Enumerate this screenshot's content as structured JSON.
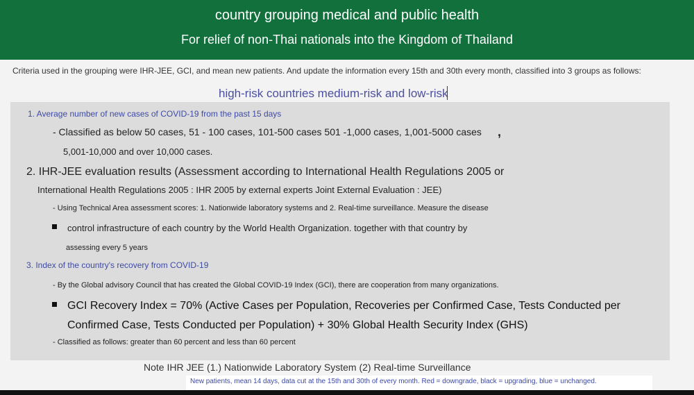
{
  "header": {
    "title": "country grouping medical and public health",
    "subtitle": "For relief of non-Thai nationals into the Kingdom of Thailand"
  },
  "criteria": "Criteria used in the grouping were IHR-JEE, GCI, and mean new patients. And update the information every 15th and 30th every month, classified into 3 groups as follows:",
  "risk_groups": "high-risk countries medium-risk and low-risk",
  "sections": {
    "s1_title": "1. Average number of new cases of COVID-19 from the past 15 days",
    "s1_line1": "- Classified as below 50 cases, 51 - 100 cases, 101-500 cases 501 -1,000 cases, 1,001-5000 cases",
    "s1_comma": ",",
    "s1_line2": "5,001-10,000 and over 10,000 cases.",
    "s2_title_line1": "2. IHR-JEE evaluation results (Assessment according to International Health Regulations 2005 or",
    "s2_title_line2": "International Health Regulations 2005 : IHR 2005 by external experts Joint External Evaluation : JEE)",
    "s2_line1": "- Using Technical Area assessment scores: 1. Nationwide laboratory systems and 2. Real-time surveillance. Measure the disease",
    "s2_bullet": "control infrastructure of each country by the World Health Organization. together with that country by",
    "s2_line3": "assessing every 5 years",
    "s3_title": "3. Index of the country's recovery from COVID-19",
    "s3_line1": "- By the Global advisory Council that has created the Global COVID-19 Index (GCI), there are cooperation from many organizations.",
    "s3_bullet_line1": "GCI Recovery Index  = 70% (Active Cases per Population, Recoveries per Confirmed Case, Tests Conducted per",
    "s3_bullet_line2": "Confirmed Case, Tests Conducted per Population) + 30% Global Health Security Index (GHS)",
    "s3_line3": "- Classified as follows: greater than 60 percent and less than 60 percent"
  },
  "note": {
    "main": "Note IHR JEE (1.) Nationwide Laboratory System (2) Real-time Surveillance",
    "sub": "New patients, mean 14 days, data cut at the 15th and 30th of every month. Red = downgrade, black = upgrading, blue = unchanged."
  },
  "colors": {
    "header_bg": "#11703c",
    "accent_blue": "#3e4aa6",
    "panel_bg": "#dcdcdc"
  }
}
